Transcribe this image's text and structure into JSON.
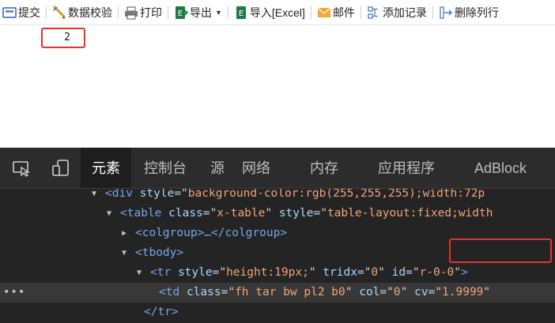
{
  "toolbar": {
    "items": [
      {
        "name": "submit",
        "label": "提交",
        "icon": "submit-icon"
      },
      {
        "name": "validate",
        "label": "数据校验",
        "icon": "validate-icon"
      },
      {
        "name": "print",
        "label": "打印",
        "icon": "printer-icon"
      },
      {
        "name": "export",
        "label": "导出",
        "icon": "excel-export-icon",
        "dropdown": true
      },
      {
        "name": "import",
        "label": "导入[Excel]",
        "icon": "excel-import-icon"
      },
      {
        "name": "mail",
        "label": "邮件",
        "icon": "mail-icon"
      },
      {
        "name": "add-record",
        "label": "添加记录",
        "icon": "add-record-icon"
      },
      {
        "name": "delete-row",
        "label": "删除列行",
        "icon": "delete-row-icon"
      }
    ]
  },
  "sheet": {
    "cell_value": "2"
  },
  "devtools": {
    "tabs": [
      "元素",
      "控制台",
      "源",
      "网络",
      "内存",
      "应用程序",
      "AdBlock"
    ],
    "active_tab": "元素",
    "dom": {
      "line1": {
        "tag": "div",
        "attr": "style",
        "value": "background-color:rgb(255,255,255);width:72p"
      },
      "line2": {
        "tag": "table",
        "attr1": "class",
        "value1": "x-table",
        "attr2": "style",
        "value2": "table-layout:fixed;width"
      },
      "line3": {
        "text": "<colgroup>…</colgroup>"
      },
      "line4": {
        "text": "<tbody>"
      },
      "line5": {
        "attr1": "style",
        "value1": "height:19px;",
        "attr2": "tridx",
        "value2": "0",
        "attr3": "id",
        "value3": "r-0-0"
      },
      "line6": {
        "attr1": "class",
        "value1": "fh tar bw pl2 b0",
        "attr2": "col",
        "value2": "0",
        "attr3": "cv",
        "value3": "1.9999"
      },
      "line7": {
        "text": "</tr>"
      }
    },
    "colors": {
      "tag": "#72a8e8",
      "attr_name": "#a6d7ff",
      "attr_value": "#f0a577",
      "highlight": "#e8312c"
    }
  }
}
